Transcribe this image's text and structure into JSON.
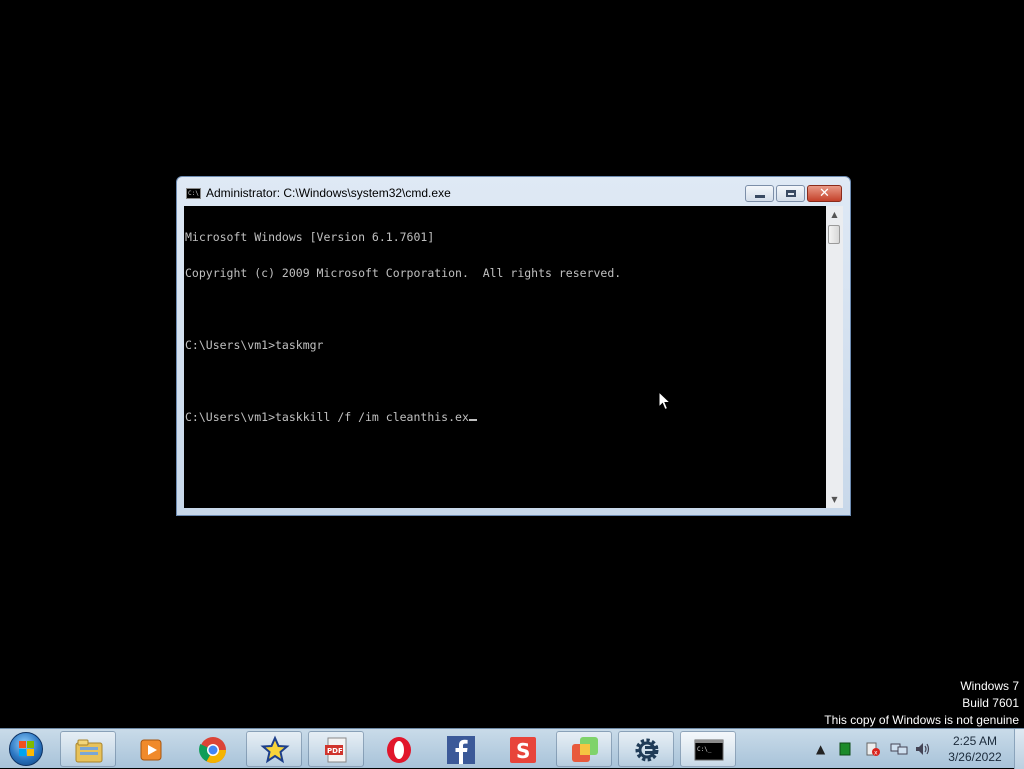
{
  "cmd_window": {
    "title": "Administrator: C:\\Windows\\system32\\cmd.exe",
    "icon_text": "C:\\",
    "buttons": {
      "minimize": "minimize-icon",
      "maximize": "maximize-icon",
      "close": "close-icon"
    },
    "console_lines": [
      "Microsoft Windows [Version 6.1.7601]",
      "Copyright (c) 2009 Microsoft Corporation.  All rights reserved.",
      "",
      "C:\\Users\\vm1>taskmgr",
      "",
      "C:\\Users\\vm1>taskkill /f /im cleanthis.ex"
    ],
    "colors": {
      "console_bg": "#000000",
      "console_text": "#c0c0c0"
    }
  },
  "watermark": {
    "line1": "Windows 7",
    "line2": "Build 7601",
    "line3": "This copy of Windows is not genuine"
  },
  "taskbar": {
    "start": "windows-start-orb",
    "pinned": [
      "windows-explorer-icon",
      "media-player-icon",
      "chrome-icon",
      "star-app-icon",
      "pdf-icon",
      "opera-icon",
      "facebook-icon",
      "s-app-icon",
      "colorful-squares-icon",
      "gear-app-icon",
      "command-prompt-icon"
    ],
    "tray": {
      "clock_time": "2:25 AM",
      "clock_date": "3/26/2022"
    }
  }
}
